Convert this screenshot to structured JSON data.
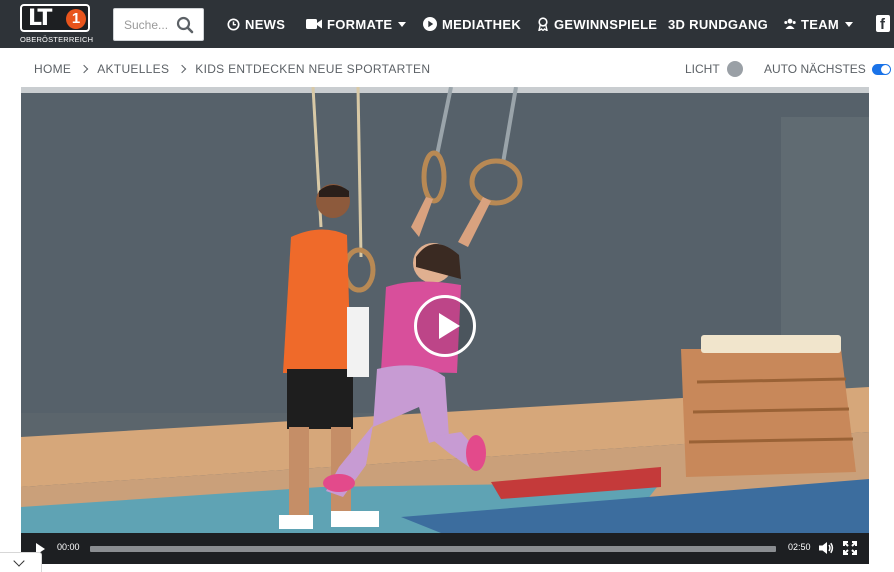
{
  "header": {
    "logo": {
      "mark": "LT",
      "number": "1",
      "subtitle": "OBERÖSTERREICH"
    },
    "search": {
      "placeholder": "Suche...",
      "value": ""
    },
    "nav": [
      {
        "label": "NEWS",
        "icon": "clock-icon"
      },
      {
        "label": "FORMATE",
        "icon": "video-camera-icon",
        "dropdown": true
      },
      {
        "label": "MEDIATHEK",
        "icon": "play-circle-icon"
      },
      {
        "label": "GEWINNSPIELE",
        "icon": "award-icon"
      },
      {
        "label": "3D RUNDGANG"
      },
      {
        "label": "TEAM",
        "icon": "team-icon",
        "dropdown": true
      }
    ],
    "social": "facebook-icon"
  },
  "breadcrumb": [
    "HOME",
    "AKTUELLES",
    "KIDS ENTDECKEN NEUE SPORTARTEN"
  ],
  "options": {
    "light_label": "LICHT",
    "autonext_label": "AUTO NÄCHSTES",
    "autonext_enabled": true
  },
  "player": {
    "current_time": "00:00",
    "duration": "02:50",
    "progress": 0
  },
  "colors": {
    "topbar": "#2e3338",
    "accent": "#e8541c",
    "toggle": "#1a73e8"
  }
}
